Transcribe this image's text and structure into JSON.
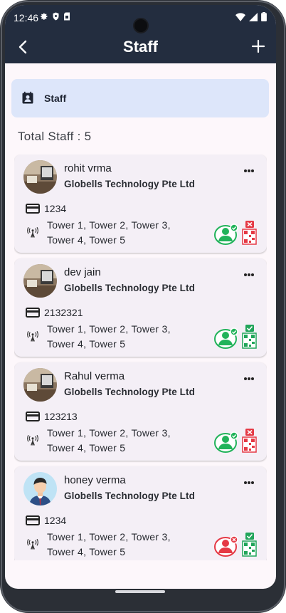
{
  "status_bar": {
    "time": "12:46"
  },
  "header": {
    "title": "Staff"
  },
  "section": {
    "label": "Staff"
  },
  "summary": {
    "total_text": "Total Staff : 5"
  },
  "colors": {
    "app_bar": "#232d3f",
    "chip_bg": "#dde6fa",
    "active_green": "#21b35a",
    "inactive_red": "#e53945"
  },
  "staff": [
    {
      "name": "rohit vrma",
      "company": "Globells Technology Pte Ltd",
      "id": "1234",
      "towers": "Tower 1, Tower 2, Tower 3, Tower 4, Tower 5",
      "avatar": "photo-avatar",
      "person_status": "active",
      "qr_status": "denied"
    },
    {
      "name": "dev jain",
      "company": "Globells Technology Pte Ltd",
      "id": "2132321",
      "towers": "Tower 1, Tower 2, Tower 3, Tower 4, Tower 5",
      "avatar": "photo-avatar",
      "person_status": "active",
      "qr_status": "approved"
    },
    {
      "name": "Rahul verma",
      "company": "Globells Technology Pte Ltd",
      "id": "123213",
      "towers": "Tower 1, Tower 2, Tower 3, Tower 4, Tower 5",
      "avatar": "photo-avatar",
      "person_status": "active",
      "qr_status": "denied"
    },
    {
      "name": "honey verma",
      "company": "Globells Technology Pte Ltd",
      "id": "1234",
      "towers": "Tower 1, Tower 2, Tower 3, Tower 4, Tower 5",
      "avatar": "cartoon-avatar",
      "person_status": "inactive",
      "qr_status": "approved"
    }
  ]
}
